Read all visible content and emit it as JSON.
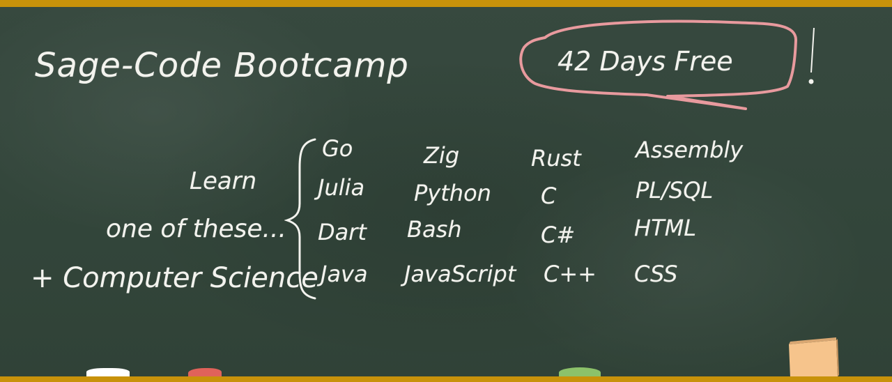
{
  "board": {
    "title": "Sage-Code Bootcamp",
    "badge": "42 Days Free",
    "labels": {
      "learn": "Learn",
      "one_of_these": "one of these...",
      "computer_science": "+ Computer Science"
    },
    "languages": [
      [
        "Go",
        "Zig",
        "Rust",
        "Assembly"
      ],
      [
        "Julia",
        "Python",
        "C",
        "PL/SQL"
      ],
      [
        "Dart",
        "Bash",
        "C#",
        "HTML"
      ],
      [
        "Java",
        "JavaScript",
        "C++",
        "CSS"
      ]
    ]
  },
  "colors": {
    "chalkboard": "#33463b",
    "frame": "#c8920a",
    "chalk_text": "#f3f3ee",
    "badge_outline": "#e89a9e",
    "chalk_white": "#ffffff",
    "chalk_red": "#e0625a",
    "chalk_green": "#8cc26a",
    "eraser": "#f6c48c"
  }
}
